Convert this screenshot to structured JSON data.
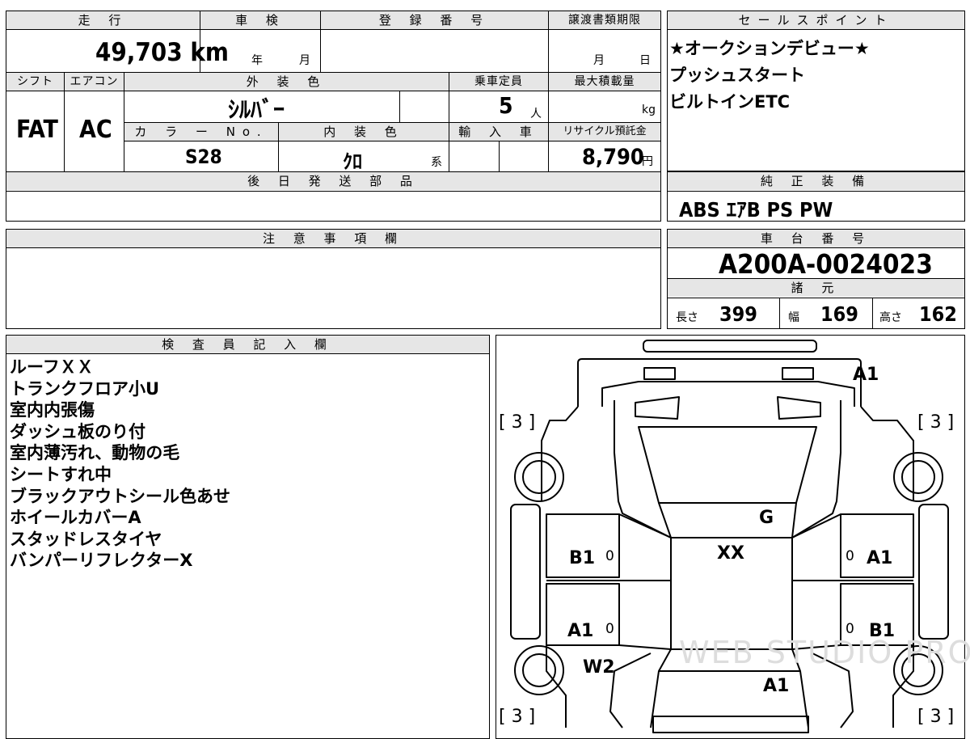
{
  "vehicle": {
    "mileage_label": "走 行",
    "mileage_value": "49,703 km",
    "inspection_label": "車 検",
    "inspection_year": "年",
    "inspection_month": "月",
    "registration_label": "登 録 番 号",
    "transfer_label": "譲渡書類期限",
    "transfer_month": "月",
    "transfer_day": "日",
    "shift_label": "シフト",
    "shift_value": "FAT",
    "ac_label": "エアコン",
    "ac_value": "AC",
    "exterior_label": "外 装 色",
    "exterior_value": "ｼﾙﾊﾞｰ",
    "capacity_label": "乗車定員",
    "capacity_value": "5",
    "capacity_unit": "人",
    "load_label": "最大積載量",
    "load_unit": "kg",
    "color_no_label": "カ ラ ー No.",
    "color_no_value": "S28",
    "interior_label": "内 装 色",
    "interior_value": "ｸﾛ",
    "interior_suffix": "系",
    "import_label": "輸 入 車",
    "recycle_label": "リサイクル預託金",
    "recycle_value": "8,790",
    "recycle_unit": "円",
    "later_parts_label": "後 日 発 送 部 品"
  },
  "sales_point": {
    "label": "セールスポイント",
    "lines": [
      "★オークションデビュー★",
      "プッシュスタート",
      "ビルトインETC"
    ]
  },
  "equipment": {
    "label": "純 正 装 備",
    "value": "ABS ｴｱB PS PW"
  },
  "notes": {
    "label": "注 意 事 項 欄"
  },
  "chassis": {
    "label": "車 台 番 号",
    "value": "A200A-0024023"
  },
  "specs": {
    "label": "諸 元",
    "length_label": "長さ",
    "length_value": "399",
    "width_label": "幅",
    "width_value": "169",
    "height_label": "高さ",
    "height_value": "162"
  },
  "inspector": {
    "label": "検 査 員 記 入 欄",
    "lines": [
      "ルーフＸＸ",
      "トランクフロア小U",
      "室内内張傷",
      "ダッシュ板のり付",
      "室内薄汚れ、動物の毛",
      "シートすれ中",
      "ブラックアウトシール色あせ",
      "ホイールカバーA",
      "スタッドレスタイヤ",
      "バンパーリフレクターX"
    ]
  },
  "diagram": {
    "tire_tl": "[ 3 ]",
    "tire_tr": "[ 3 ]",
    "tire_bl": "[ 3 ]",
    "tire_br": "[ 3 ]",
    "rear_right": "A1",
    "glass": "G",
    "roof": "XX",
    "left_rear_door": "B1",
    "left_rear_door_small": "0",
    "right_rear_door": "A1",
    "right_rear_door_small": "0",
    "left_front_door": "A1",
    "left_front_door_small": "0",
    "right_front_door": "B1",
    "right_front_door_small": "0",
    "left_front_fender": "W2",
    "hood": "A1",
    "watermark": "WEB STUDIO PRO"
  }
}
